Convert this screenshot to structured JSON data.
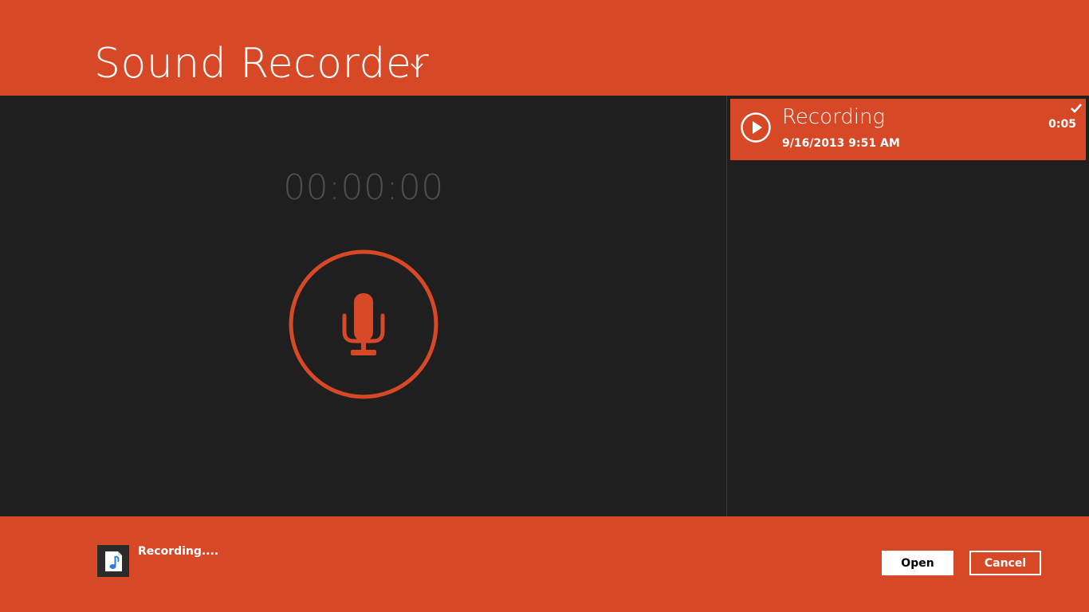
{
  "app": {
    "title": "Sound Recorder",
    "accent_color": "#d64826",
    "background_color": "#1f1f1f"
  },
  "recorder": {
    "timer": "00:00:00",
    "record_icon": "microphone-icon"
  },
  "recordings": [
    {
      "name": "Recording",
      "date": "9/16/2013 9:51 AM",
      "duration": "0:05",
      "selected": true,
      "play_icon": "play-icon",
      "check_icon": "check-icon"
    }
  ],
  "footer": {
    "file_icon": "audio-file-icon",
    "status": "Recording....",
    "open_label": "Open",
    "cancel_label": "Cancel"
  }
}
